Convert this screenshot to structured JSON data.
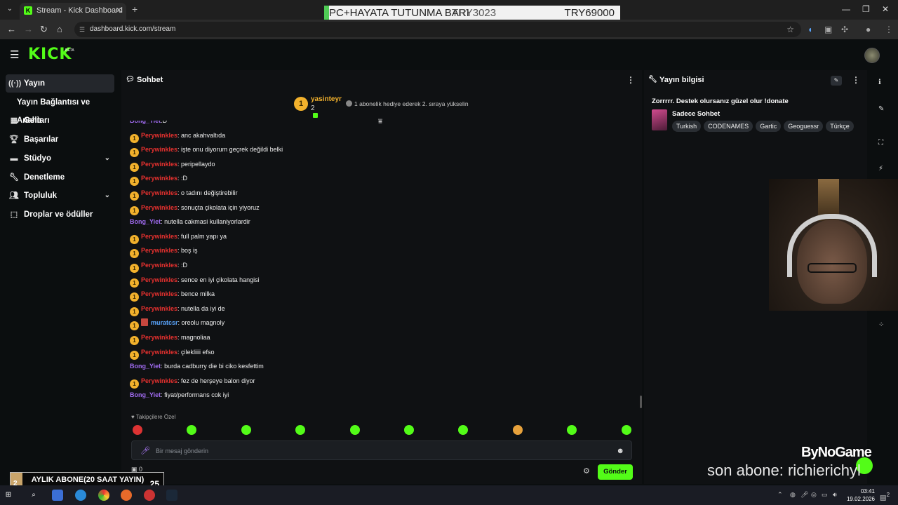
{
  "browser": {
    "tab_title": "Stream - Kick Dashboard",
    "url": "dashboard.kick.com/stream",
    "favicon_letter": "K"
  },
  "ticker": {
    "text1": "PC+HAYATA TUTUNMA BARI",
    "text2": "TRY3023",
    "text3": "TRY69000"
  },
  "header": {
    "logo": "KICK",
    "beta": "BETA"
  },
  "sidebar": {
    "items": [
      {
        "label": "Yayın",
        "icon": "broadcast-icon"
      },
      {
        "label": "Yayın Bağlantısı ve Anahtarı"
      },
      {
        "label": "Gelir",
        "icon": "revenue-icon"
      },
      {
        "label": "Başarılar",
        "icon": "trophy-icon"
      },
      {
        "label": "Stüdyo",
        "icon": "studio-icon"
      },
      {
        "label": "Denetleme",
        "icon": "wrench-icon"
      },
      {
        "label": "Topluluk",
        "icon": "community-icon"
      },
      {
        "label": "Droplar ve ödüller",
        "icon": "drops-icon"
      }
    ]
  },
  "chat": {
    "title": "Sohbet",
    "pinned": {
      "rank": "1",
      "user": "yasinteyr",
      "count": "2",
      "text": "1 abonelik hediye ederek 2. sıraya yükselin"
    },
    "messages": [
      {
        "user": "Bong_Yiet",
        "text": ":D",
        "badge": "",
        "color": "purple"
      },
      {
        "user": "Perywinkles",
        "text": ": anc akahvaltıda",
        "badge": "1",
        "color": "red"
      },
      {
        "user": "Perywinkles",
        "text": ": işte onu diyorum geçrek değildi belki",
        "badge": "1",
        "color": "red"
      },
      {
        "user": "Perywinkles",
        "text": ": peripellaydo",
        "badge": "1",
        "color": "red"
      },
      {
        "user": "Perywinkles",
        "text": ": :D",
        "badge": "1",
        "color": "red"
      },
      {
        "user": "Perywinkles",
        "text": ": o tadını değiştirebilir",
        "badge": "1",
        "color": "red"
      },
      {
        "user": "Perywinkles",
        "text": ": sonuçta çikolata için yiyoruz",
        "badge": "1",
        "color": "red"
      },
      {
        "user": "Bong_Yiet",
        "text": ": nutella cakmasi kullaniyorlardir",
        "badge": "",
        "color": "purple"
      },
      {
        "user": "Perywinkles",
        "text": ": full palm yapı ya",
        "badge": "1",
        "color": "red"
      },
      {
        "user": "Perywinkles",
        "text": ": boş iş",
        "badge": "1",
        "color": "red"
      },
      {
        "user": "Perywinkles",
        "text": ": :D",
        "badge": "1",
        "color": "red"
      },
      {
        "user": "Perywinkles",
        "text": ": sence en iyi çikolata hangisi",
        "badge": "1",
        "color": "red"
      },
      {
        "user": "Perywinkles",
        "text": ": bence milka",
        "badge": "1",
        "color": "red"
      },
      {
        "user": "Perywinkles",
        "text": ": nutella da iyi de",
        "badge": "1",
        "color": "red"
      },
      {
        "user": "muratcsr",
        "text": ": oreolu magnoly",
        "badge": "1",
        "color": "blue",
        "gift": true
      },
      {
        "user": "Perywinkles",
        "text": ": magnoliaa",
        "badge": "1",
        "color": "red"
      },
      {
        "user": "Perywinkles",
        "text": ": çilekliiii efso",
        "badge": "1",
        "color": "red"
      },
      {
        "user": "Bong_Yiet",
        "text": ": burda cadburry die bi ciko kesfettim",
        "badge": "",
        "color": "purple"
      },
      {
        "user": "Perywinkles",
        "text": ": fez de herşeye balon diyor",
        "badge": "1",
        "color": "red"
      },
      {
        "user": "Bong_Yiet",
        "text": ": fiyat/performans cok iyi",
        "badge": "",
        "color": "purple"
      }
    ],
    "emotes_label": "Takipçilere Özel",
    "input_placeholder": "Bir mesaj gönderin",
    "bot_count": "0",
    "send_label": "Gönder"
  },
  "stream_info": {
    "title": "Yayın bilgisi",
    "stream_title": "Zorrrrr. Destek olursanız güzel olur !donate",
    "category": "Sadece Sohbet",
    "tags": [
      "Turkish",
      "CODENAMES",
      "Gartic",
      "Geoguessr",
      "Türkçe"
    ]
  },
  "overlays": {
    "watermark": "ByNoGame",
    "last_sub": "son abone: richierichyl",
    "goal_label": "AYLIK ABONE(20 SAAT YAYIN)",
    "goal_current": "2",
    "goal_total": "25",
    "goal_fraction": 0.08
  },
  "taskbar": {
    "time": "03:41",
    "date": "19.02.2026",
    "notif_count": "2"
  },
  "colors": {
    "kick_green": "#53fc18",
    "sub_gold": "#f2b12c",
    "user_red": "#e8312f",
    "user_purple": "#a06bf0",
    "user_blue": "#5aa6ff"
  }
}
